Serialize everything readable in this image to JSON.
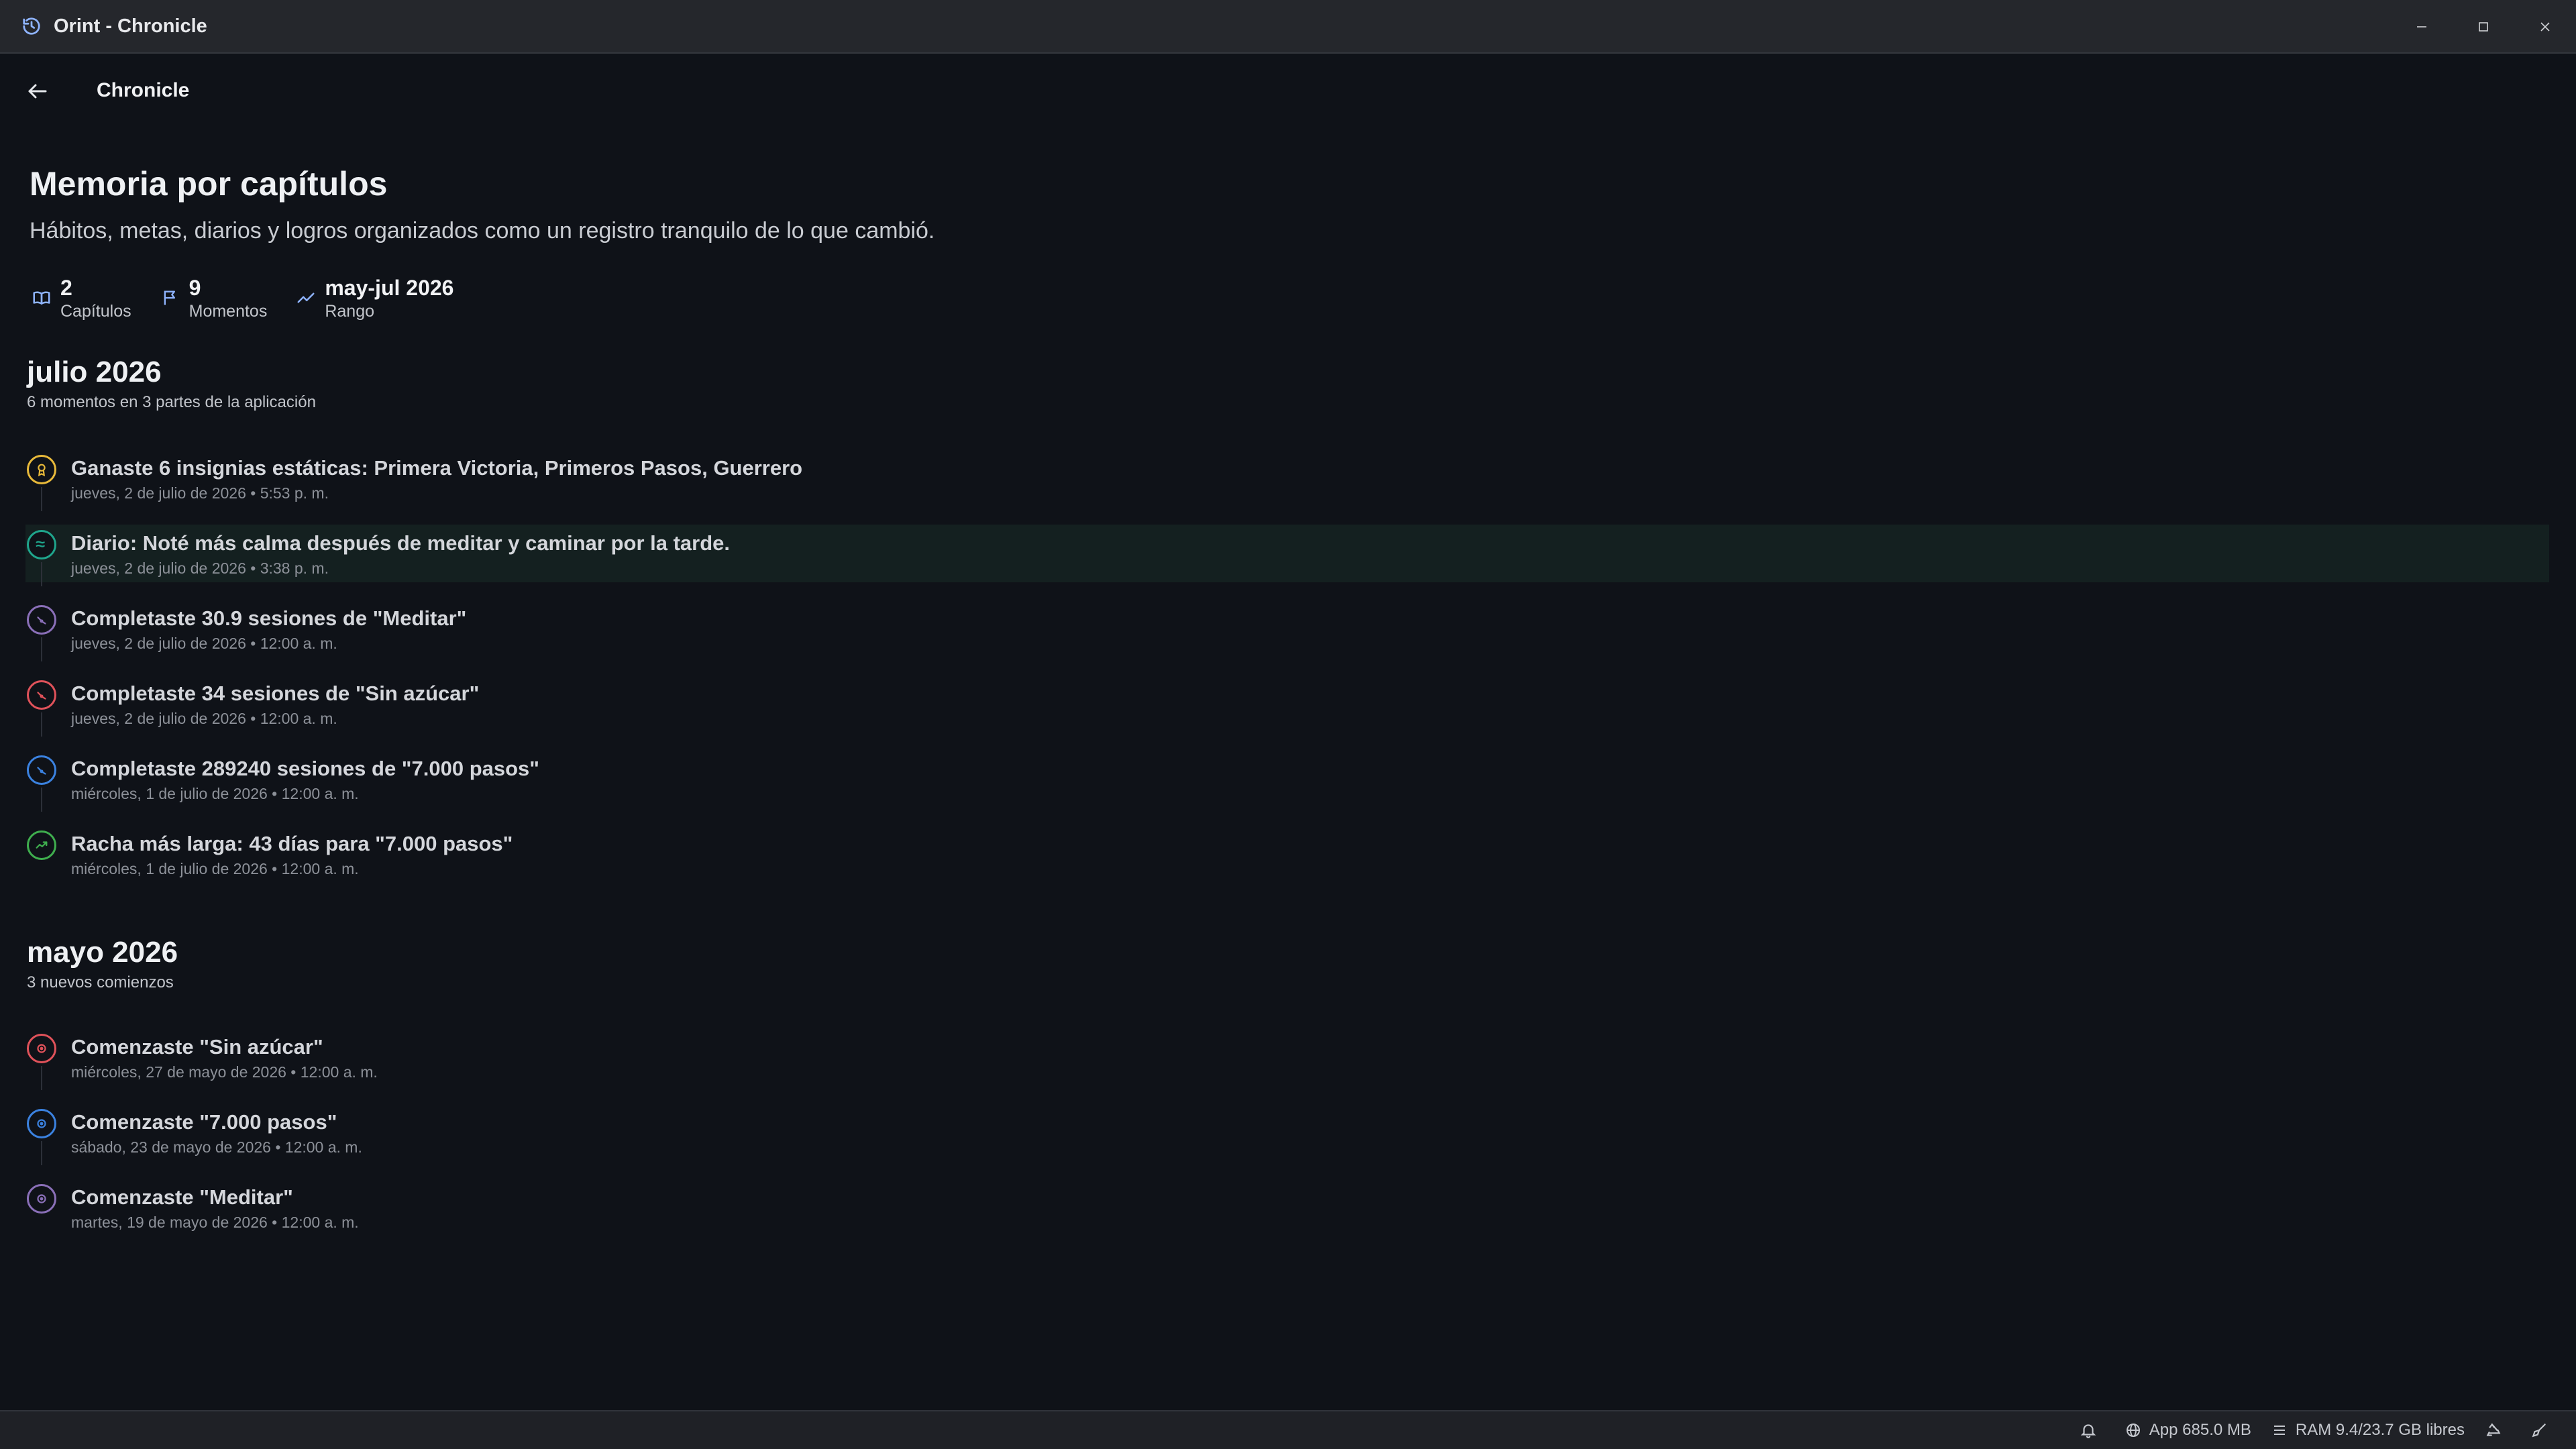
{
  "window": {
    "title": "Orint - Chronicle"
  },
  "nav": {
    "title": "Chronicle"
  },
  "header": {
    "title": "Memoria por capítulos",
    "subtitle": "Hábitos, metas, diarios y logros organizados como un registro tranquilo de lo que cambió."
  },
  "stats": [
    {
      "value": "2",
      "label": "Capítulos",
      "icon": "book-icon"
    },
    {
      "value": "9",
      "label": "Momentos",
      "icon": "flag-icon"
    },
    {
      "value": "may-jul 2026",
      "label": "Rango",
      "icon": "trend-icon"
    }
  ],
  "chapters": [
    {
      "title": "julio 2026",
      "subtitle": "6 momentos en 3 partes de la aplicación",
      "events": [
        {
          "title": "Ganaste 6 insignias estáticas: Primera Victoria, Primeros Pasos, Guerrero",
          "date": "jueves, 2 de julio de 2026 • 5:53 p. m.",
          "color": "#e8b93a",
          "icon": "badge-icon"
        },
        {
          "title": "Diario: Noté más calma después de meditar y caminar por la tarde.",
          "date": "jueves, 2 de julio de 2026 • 3:38 p. m.",
          "color": "#1fa58c",
          "icon": "journal-icon"
        },
        {
          "title": "Completaste 30.9 sesiones de \"Meditar\"",
          "date": "jueves, 2 de julio de 2026 • 12:00 a. m.",
          "color": "#8a6fb8",
          "icon": "habit-icon"
        },
        {
          "title": "Completaste 34 sesiones de \"Sin azúcar\"",
          "date": "jueves, 2 de julio de 2026 • 12:00 a. m.",
          "color": "#e0525a",
          "icon": "habit-icon"
        },
        {
          "title": "Completaste 289240 sesiones de \"7.000 pasos\"",
          "date": "miércoles, 1 de julio de 2026 • 12:00 a. m.",
          "color": "#3b82e0",
          "icon": "habit-icon"
        },
        {
          "title": "Racha más larga: 43 días para \"7.000 pasos\"",
          "date": "miércoles, 1 de julio de 2026 • 12:00 a. m.",
          "color": "#3fae4e",
          "icon": "streak-icon"
        }
      ]
    },
    {
      "title": "mayo 2026",
      "subtitle": "3 nuevos comienzos",
      "events": [
        {
          "title": "Comenzaste \"Sin azúcar\"",
          "date": "miércoles, 27 de mayo de 2026 • 12:00 a. m.",
          "color": "#e0525a",
          "icon": "start-icon"
        },
        {
          "title": "Comenzaste \"7.000 pasos\"",
          "date": "sábado, 23 de mayo de 2026 • 12:00 a. m.",
          "color": "#3b82e0",
          "icon": "start-icon"
        },
        {
          "title": "Comenzaste \"Meditar\"",
          "date": "martes, 19 de mayo de 2026 • 12:00 a. m.",
          "color": "#8a6fb8",
          "icon": "start-icon"
        }
      ]
    }
  ],
  "statusbar": {
    "app_memory": "App 685.0 MB",
    "ram": "RAM 9.4/23.7 GB libres"
  }
}
